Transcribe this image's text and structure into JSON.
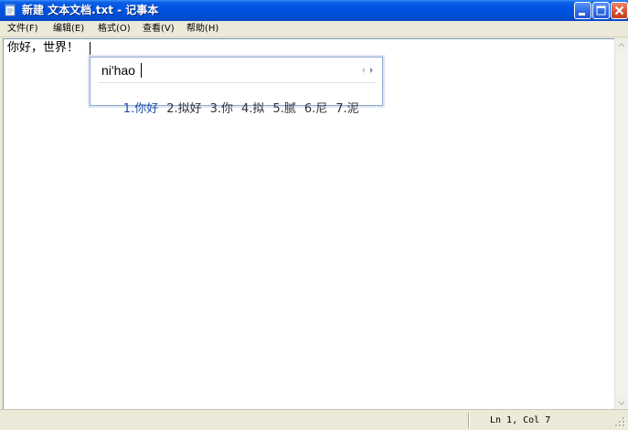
{
  "window": {
    "title": "新建 文本文档.txt - 记事本"
  },
  "menu": [
    {
      "label": "文件(F)"
    },
    {
      "label": "编辑(E)"
    },
    {
      "label": "格式(O)"
    },
    {
      "label": "查看(V)"
    },
    {
      "label": "帮助(H)"
    }
  ],
  "editor": {
    "content": "你好，世界！"
  },
  "ime": {
    "composition": "ni'hao",
    "candidates": [
      {
        "label": "1.你好",
        "selected": true
      },
      {
        "label": "2.拟好",
        "selected": false
      },
      {
        "label": "3.你",
        "selected": false
      },
      {
        "label": "4.拟",
        "selected": false
      },
      {
        "label": "5.腻",
        "selected": false
      },
      {
        "label": "6.尼",
        "selected": false
      },
      {
        "label": "7.泥",
        "selected": false
      }
    ]
  },
  "status": {
    "position": "Ln 1, Col 7"
  },
  "icons": {
    "app": "notepad-icon",
    "minimize": "minimize-icon",
    "maximize": "maximize-icon",
    "close": "close-icon"
  },
  "colors": {
    "titlebar": "#0054e3",
    "close_button": "#d4502f",
    "selected_candidate": "#1c4fa8"
  }
}
